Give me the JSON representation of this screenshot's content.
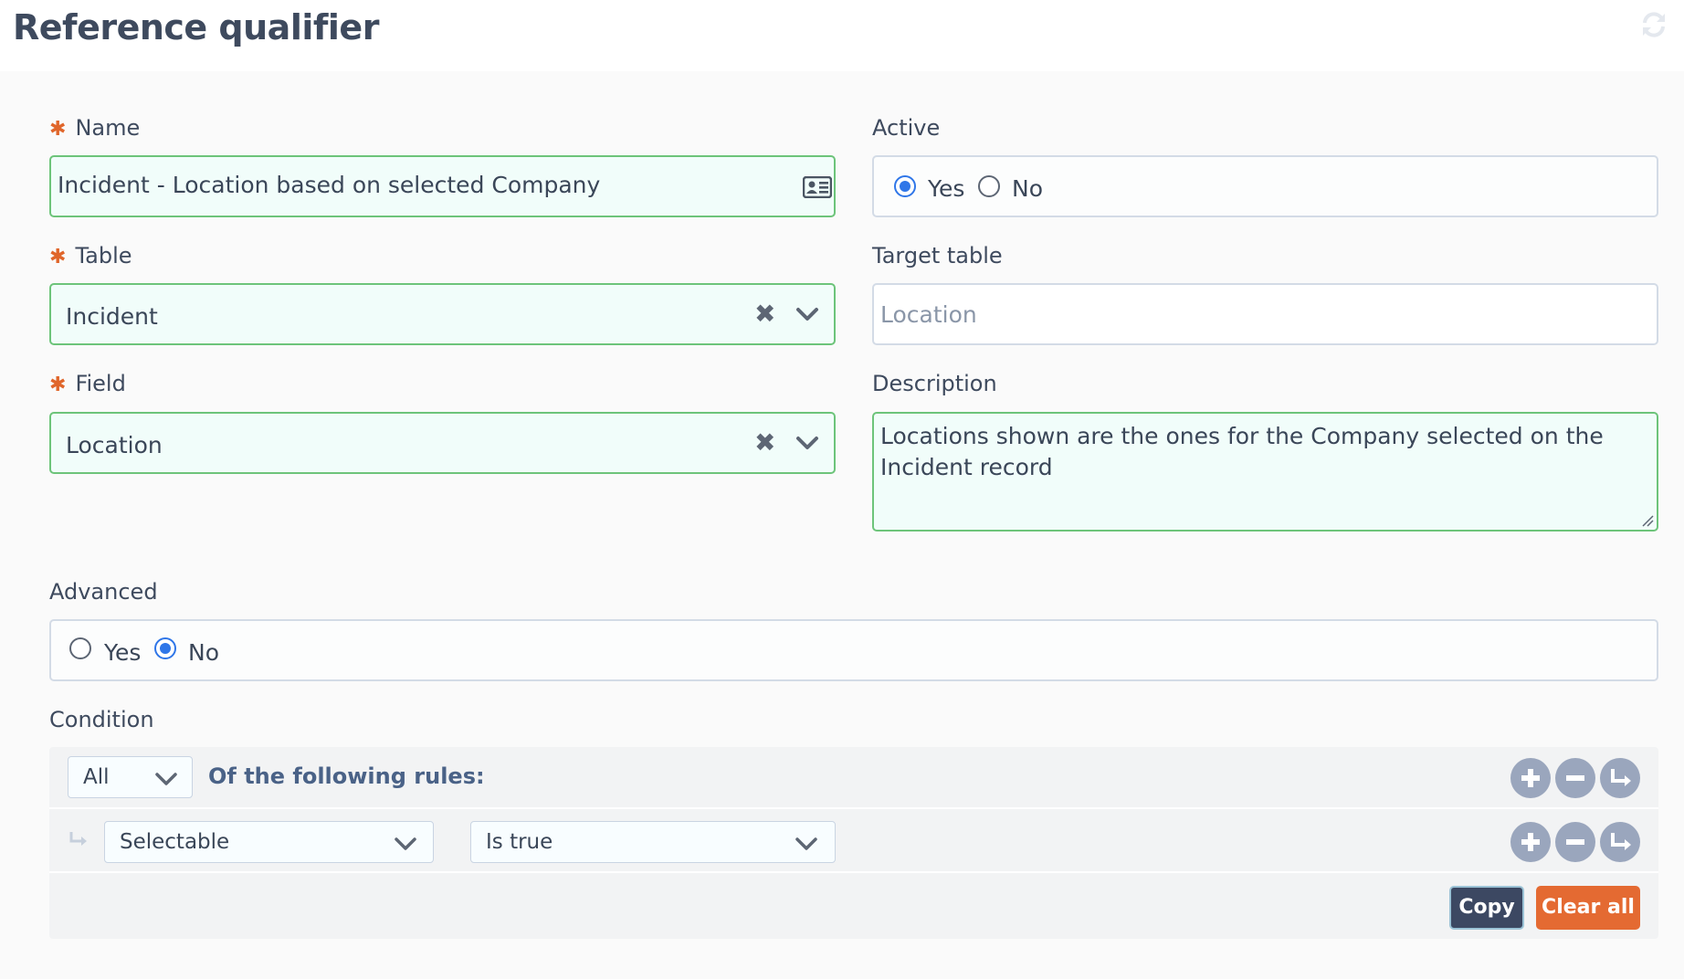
{
  "header": {
    "title": "Reference qualifier",
    "refresh_icon": "refresh-icon"
  },
  "form": {
    "name": {
      "label": "Name",
      "required": true,
      "value": "Incident - Location based on selected Company",
      "icon": "contact-card-icon"
    },
    "active": {
      "label": "Active",
      "options": [
        "Yes",
        "No"
      ],
      "selected": "Yes"
    },
    "table": {
      "label": "Table",
      "required": true,
      "value": "Incident"
    },
    "target_table": {
      "label": "Target table",
      "placeholder": "Location"
    },
    "field": {
      "label": "Field",
      "required": true,
      "value": "Location"
    },
    "description": {
      "label": "Description",
      "value": "Locations shown are the ones for the Company selected on the Incident record"
    },
    "advanced": {
      "label": "Advanced",
      "options": [
        "Yes",
        "No"
      ],
      "selected": "No"
    }
  },
  "condition": {
    "label": "Condition",
    "match_select": "All",
    "rules_label": "Of the following rules:",
    "rule": {
      "field": "Selectable",
      "operator": "Is true"
    },
    "copy_label": "Copy",
    "clear_all_label": "Clear all"
  },
  "colors": {
    "accent_green": "#6dc47a",
    "field_fill": "#f1fdfa",
    "radio_blue": "#2f76e8",
    "required_orange": "#e0662b",
    "copy_button": "#3c4862",
    "clear_button": "#e46a32"
  }
}
